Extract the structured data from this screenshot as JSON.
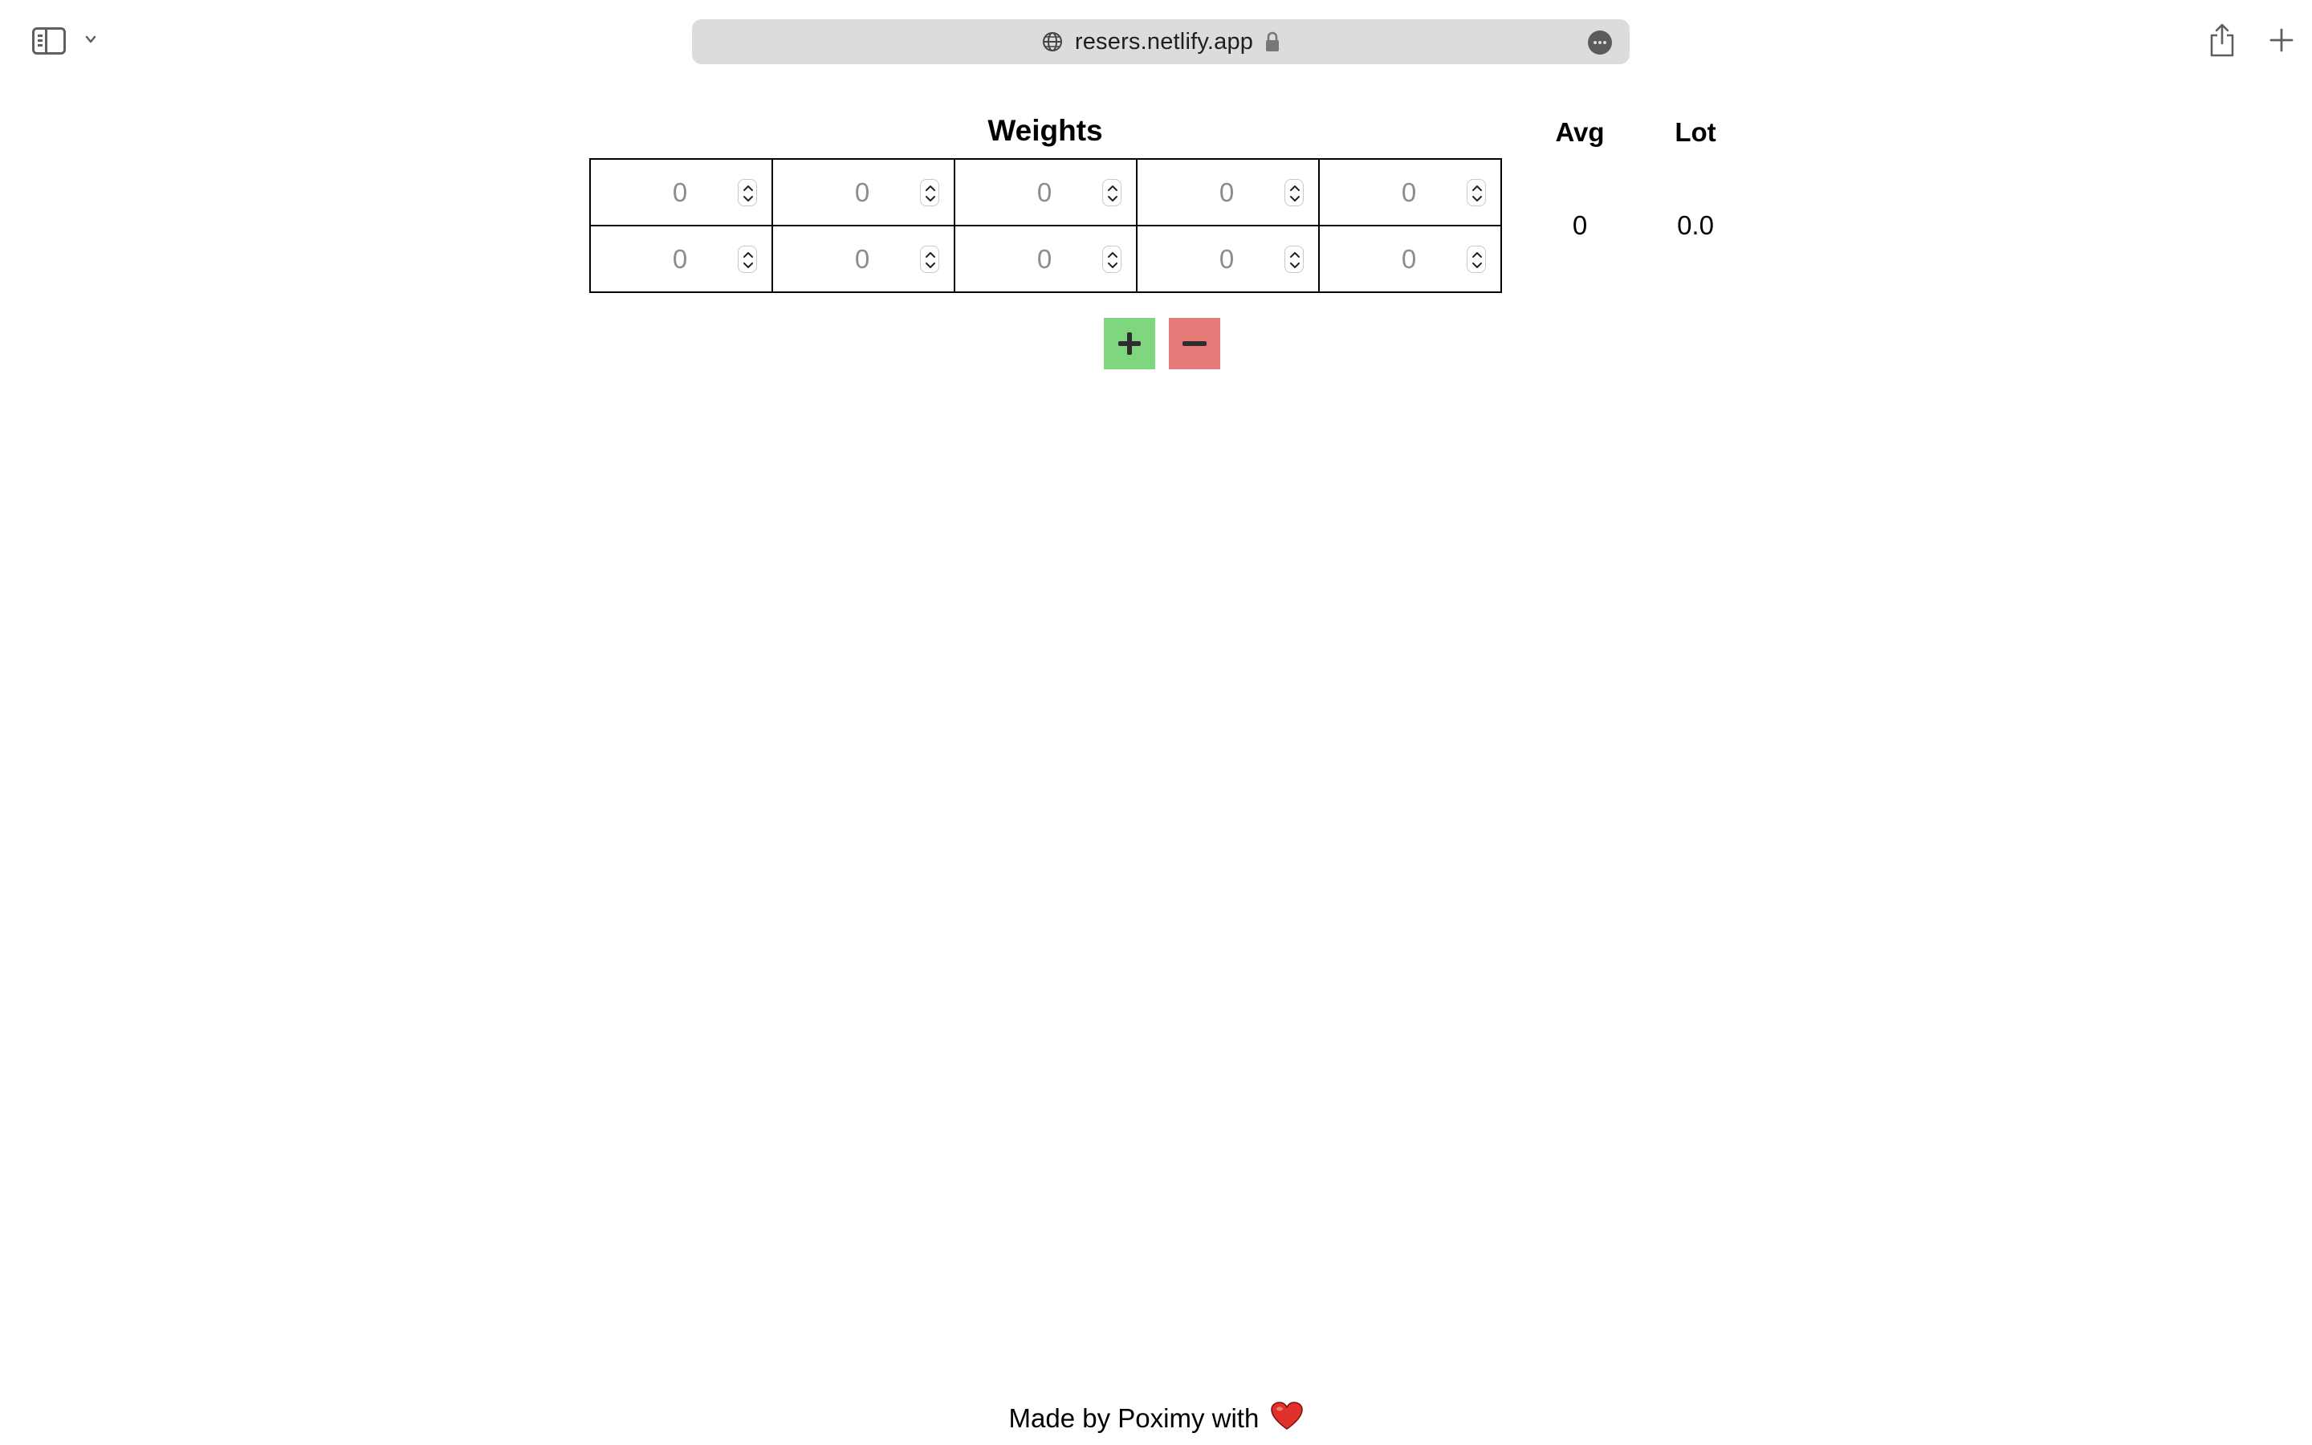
{
  "browser": {
    "url": "resers.netlify.app",
    "icons": {
      "sidebar": "sidebar-toggle-icon",
      "chevron": "chevron-down-icon",
      "site": "globe-icon",
      "secure": "lock-icon",
      "page_menu": "more-icon",
      "share": "share-icon",
      "new_tab": "plus-icon"
    }
  },
  "weights": {
    "title": "Weights",
    "rows": [
      [
        "0",
        "0",
        "0",
        "0",
        "0"
      ],
      [
        "0",
        "0",
        "0",
        "0",
        "0"
      ]
    ]
  },
  "stats": {
    "avg_label": "Avg",
    "avg_value": "0",
    "lot_label": "Lot",
    "lot_value": "0.0"
  },
  "controls": {
    "add_icon": "plus-icon",
    "remove_icon": "minus-icon",
    "add_color": "#7ed67f",
    "remove_color": "#e57a78"
  },
  "footer": {
    "text": "Made by Poximy with",
    "icon": "heart-icon"
  }
}
